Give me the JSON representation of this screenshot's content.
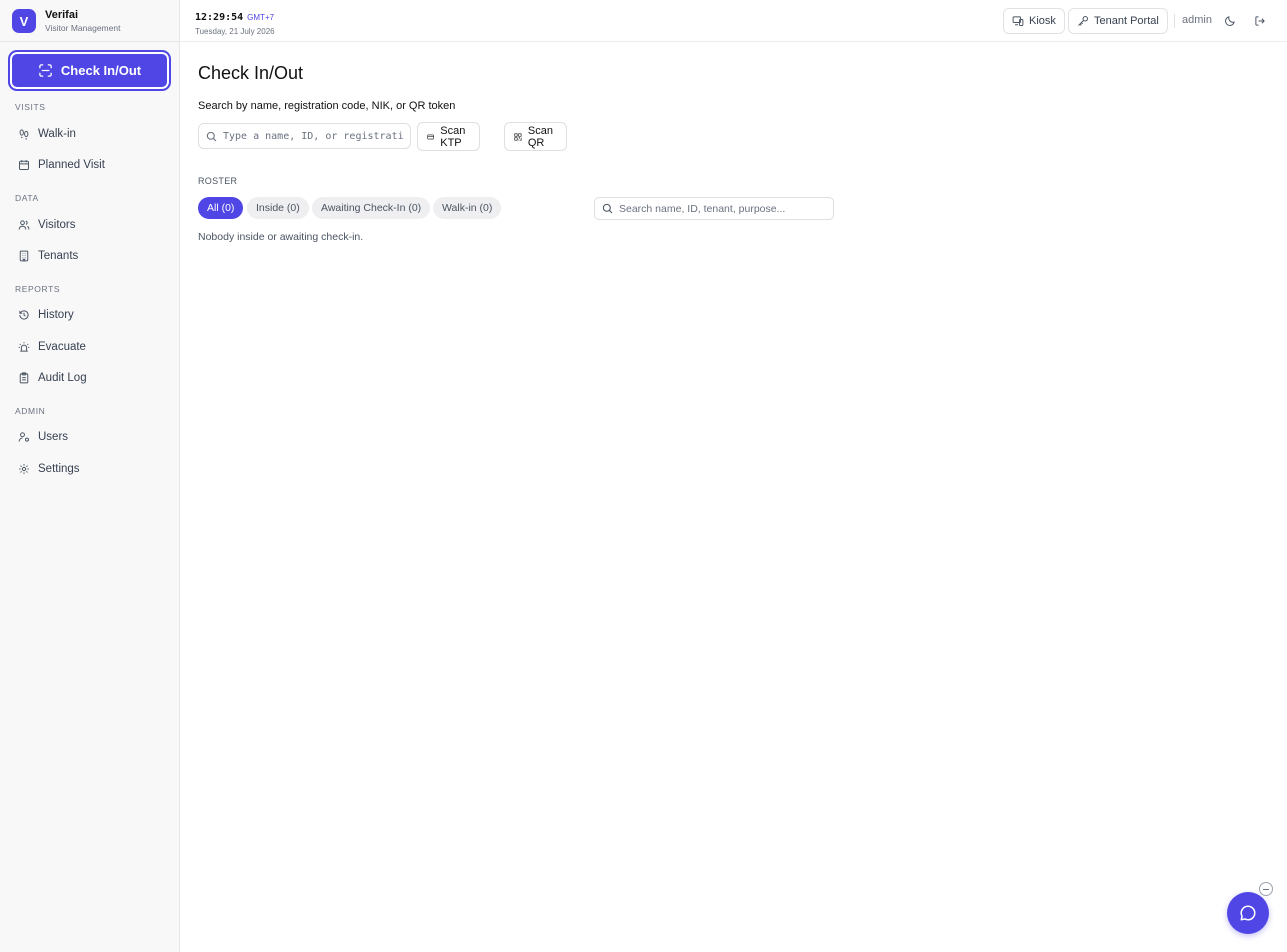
{
  "brand": {
    "initial": "V",
    "name": "Verifai",
    "subtitle": "Visitor Management"
  },
  "sidebar": {
    "cta_label": "Check In/Out",
    "sections": [
      {
        "title": "VISITS",
        "items": [
          {
            "label": "Walk-in",
            "icon": "footprints-icon"
          },
          {
            "label": "Planned Visit",
            "icon": "calendar-icon"
          }
        ]
      },
      {
        "title": "DATA",
        "items": [
          {
            "label": "Visitors",
            "icon": "users-icon"
          },
          {
            "label": "Tenants",
            "icon": "building-icon"
          }
        ]
      },
      {
        "title": "REPORTS",
        "items": [
          {
            "label": "History",
            "icon": "history-icon"
          },
          {
            "label": "Evacuate",
            "icon": "siren-icon"
          },
          {
            "label": "Audit Log",
            "icon": "clipboard-icon"
          }
        ]
      },
      {
        "title": "ADMIN",
        "items": [
          {
            "label": "Users",
            "icon": "user-key-icon"
          },
          {
            "label": "Settings",
            "icon": "gear-icon"
          }
        ]
      }
    ]
  },
  "topbar": {
    "time": "12:29:54",
    "timezone": "GMT+7",
    "date": "Tuesday, 21 July 2026",
    "kiosk_label": "Kiosk",
    "tenant_portal_label": "Tenant Portal",
    "user": "admin"
  },
  "main": {
    "title": "Check In/Out",
    "search_label": "Search by name, registration code, NIK, or QR token",
    "search_placeholder": "Type a name, ID, or registration code",
    "scan_ktp_label": "Scan KTP",
    "scan_qr_label": "Scan QR",
    "roster_label": "ROSTER",
    "filters": [
      "All (0)",
      "Inside (0)",
      "Awaiting Check-In (0)",
      "Walk-in (0)"
    ],
    "active_filter": "All (0)",
    "roster_search_placeholder": "Search name, ID, tenant, purpose...",
    "empty_message": "Nobody inside or awaiting check-in."
  },
  "colors": {
    "accent": "#4f46e5"
  }
}
